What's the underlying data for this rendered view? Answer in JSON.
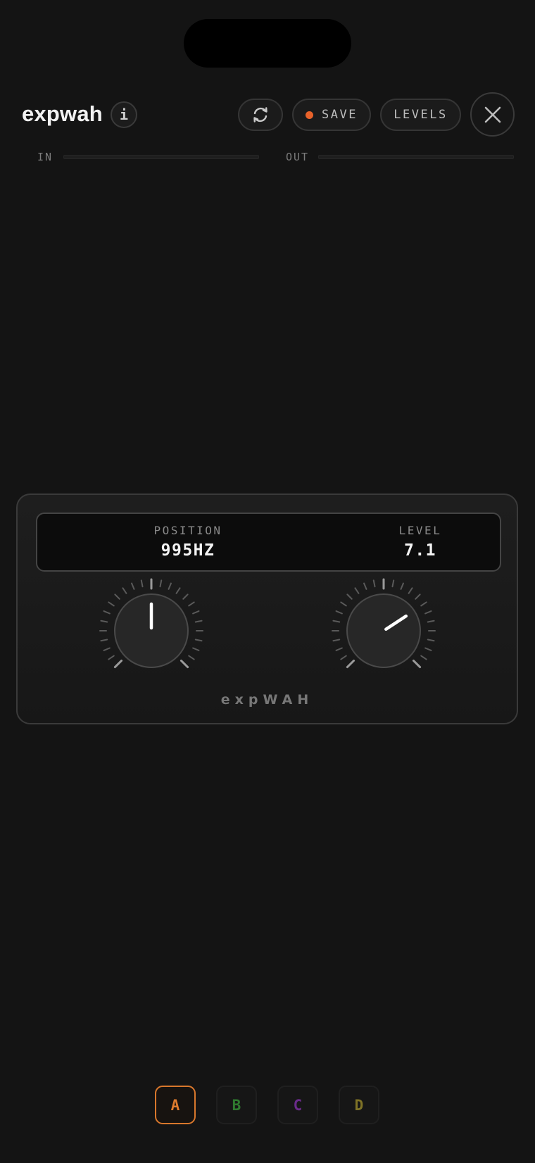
{
  "header": {
    "title": "expwah",
    "info_label": "i",
    "save_label": "SAVE",
    "levels_label": "LEVELS",
    "save_dot_color": "#e8622a",
    "icons": {
      "info": "info-icon",
      "sync": "sync-icon",
      "close": "close-icon"
    }
  },
  "meters": {
    "in_label": "IN",
    "out_label": "OUT"
  },
  "panel": {
    "readouts": [
      {
        "label": "POSITION",
        "value": "995HZ"
      },
      {
        "label": "LEVEL",
        "value": "7.1"
      }
    ],
    "knobs": [
      {
        "name": "position",
        "fraction": 0.5
      },
      {
        "name": "level",
        "fraction": 0.71
      }
    ],
    "brand": "expWAH"
  },
  "slots": [
    {
      "label": "A",
      "color": "#e07c2e",
      "active": true
    },
    {
      "label": "B",
      "color": "#2f7a2f",
      "active": false
    },
    {
      "label": "C",
      "color": "#6a2b8a",
      "active": false
    },
    {
      "label": "D",
      "color": "#7f7326",
      "active": false
    }
  ]
}
